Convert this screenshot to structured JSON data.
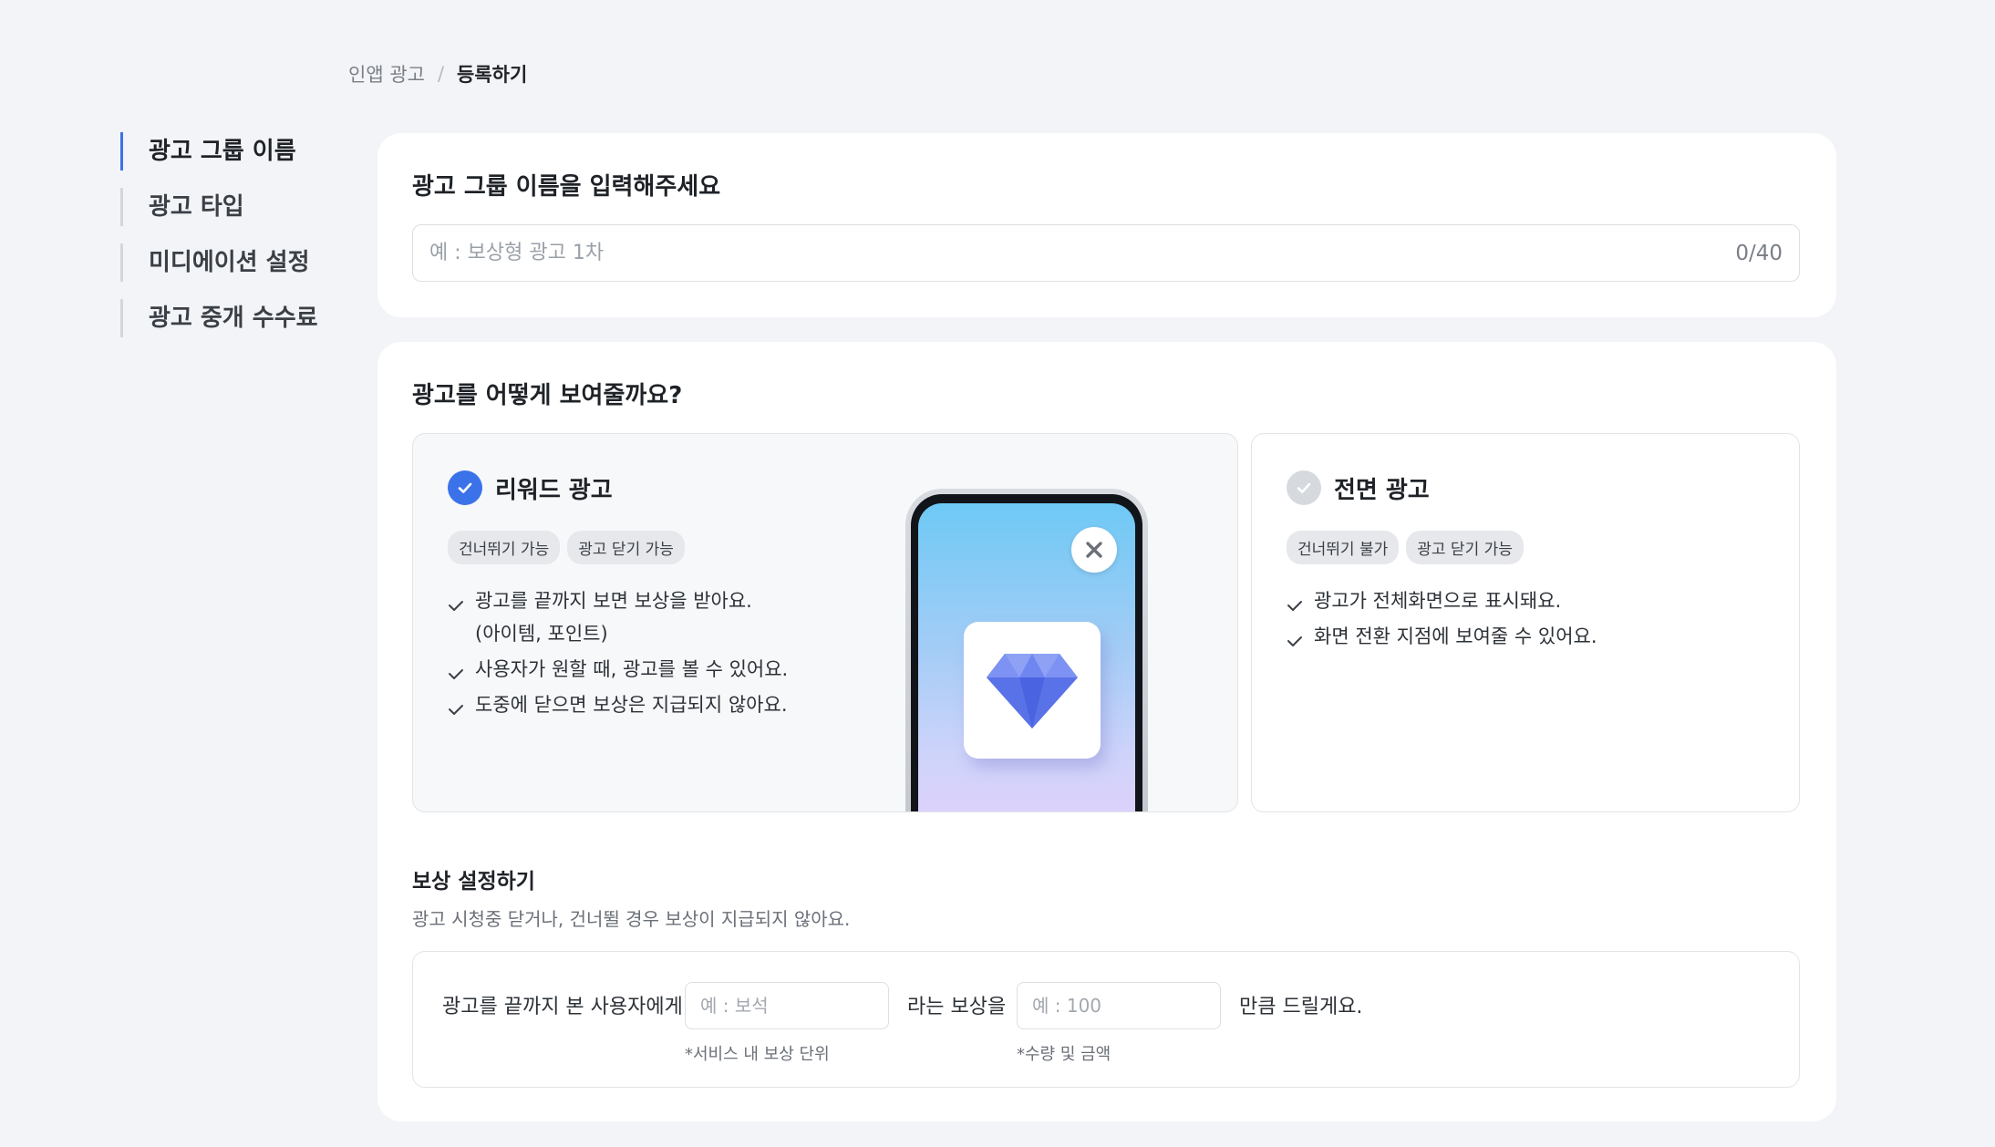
{
  "breadcrumb": {
    "parent": "인앱 광고",
    "separator": "/",
    "current": "등록하기"
  },
  "side_nav": {
    "items": [
      {
        "label": "광고 그룹 이름"
      },
      {
        "label": "광고 타입"
      },
      {
        "label": "미디에이션 설정"
      },
      {
        "label": "광고 중개 수수료"
      }
    ]
  },
  "name_section": {
    "title": "광고 그룹 이름을 입력해주세요",
    "placeholder": "예 : 보상형 광고 1차",
    "value": "",
    "counter": "0/40"
  },
  "type_section": {
    "title": "광고를 어떻게 보여줄까요?",
    "options": [
      {
        "title": "리워드 광고",
        "selected": true,
        "tags": [
          "건너뛰기 가능",
          "광고 닫기 가능"
        ],
        "bullets": [
          {
            "text": "광고를 끝까지 보면 보상을 받아요.",
            "sub": "(아이템, 포인트)"
          },
          {
            "text": "사용자가 원할 때, 광고를 볼 수 있어요."
          },
          {
            "text": "도중에 닫으면 보상은 지급되지 않아요."
          }
        ]
      },
      {
        "title": "전면 광고",
        "selected": false,
        "tags": [
          "건너뛰기 불가",
          "광고 닫기 가능"
        ],
        "bullets": [
          {
            "text": "광고가 전체화면으로 표시돼요."
          },
          {
            "text": "화면 전환 지점에 보여줄 수 있어요."
          }
        ]
      }
    ]
  },
  "reward_section": {
    "title": "보상 설정하기",
    "description": "광고 시청중 닫거나, 건너뛸 경우 보상이 지급되지 않아요.",
    "prefix": "광고를 끝까지 본 사용자에게",
    "reward_name_placeholder": "예 : 보석",
    "middle": "라는 보상을",
    "amount_placeholder": "예 : 100",
    "suffix": "만큼 드릴게요.",
    "reward_name_hint": "*서비스 내 보상 단위",
    "amount_hint": "*수량 및 금액"
  },
  "icons": {
    "selected_check": "check-circle-icon",
    "unselected_check": "check-circle-icon",
    "bullet": "check-icon",
    "phone_close": "close-icon",
    "phone_reward": "diamond-icon"
  },
  "colors": {
    "accent": "#3b72ea",
    "background": "#f3f4f7",
    "card": "#ffffff",
    "unselected": "#d6d9de"
  }
}
